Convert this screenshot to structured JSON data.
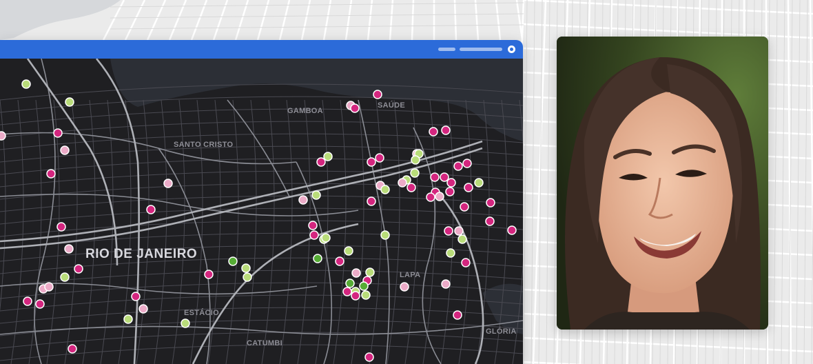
{
  "map": {
    "city_label": "RIO DE JANEIRO",
    "districts": [
      "GAMBOA",
      "SAÚDE",
      "SANTO CRISTO",
      "ESTÁCIO",
      "CATUMBI",
      "GLÓRIA",
      "LAPA"
    ],
    "marker_colors": {
      "magenta": "#d4267f",
      "pink": "#ecabc8",
      "light_green": "#b9dc7a",
      "green": "#56ac35"
    }
  },
  "window": {
    "accent_color": "#2c6bd9",
    "map_background": "#1f1f22"
  },
  "photo": {
    "subject": "portrait-photo"
  }
}
